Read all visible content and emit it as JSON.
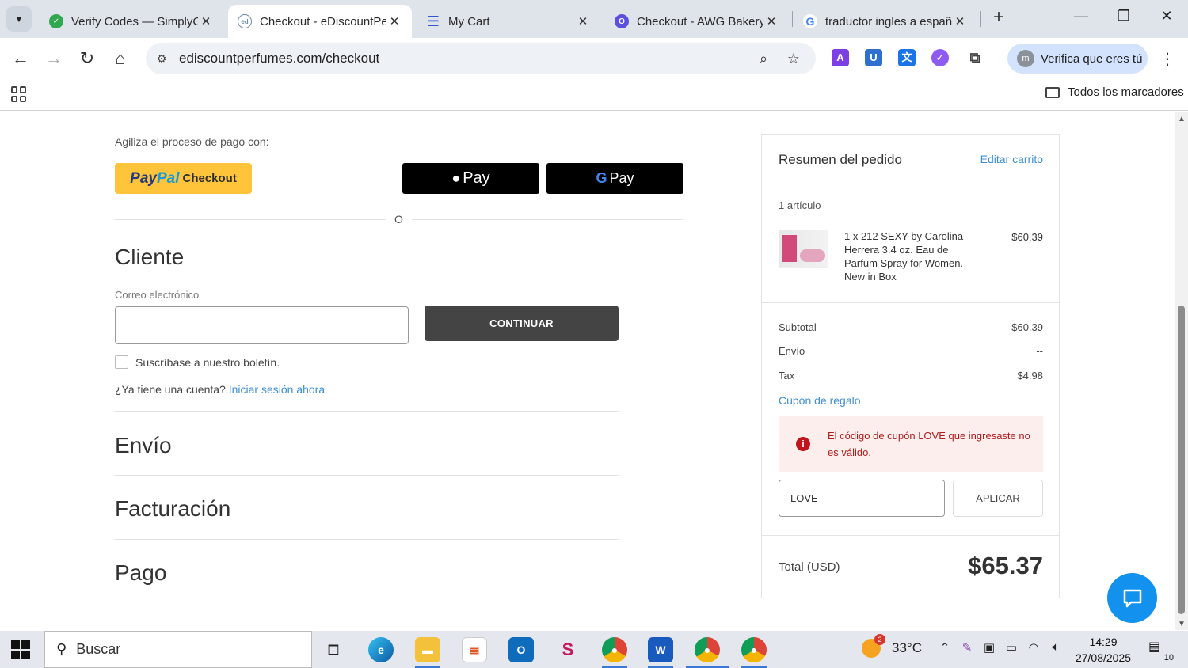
{
  "tabs": [
    {
      "title": "Verify Codes — SimplyCodes",
      "favicon": "simplycodes-icon",
      "color": "#2fa84f",
      "active": false
    },
    {
      "title": "Checkout - eDiscountPerfumes",
      "favicon": "ediscountperfumes-icon",
      "color": "#6f8aa3",
      "active": true
    },
    {
      "title": "My Cart",
      "favicon": "menu-icon",
      "color": "#3457d5",
      "active": false
    },
    {
      "title": "Checkout - AWG Bakery",
      "favicon": "awg-icon",
      "color": "#5b4fe0",
      "active": false
    },
    {
      "title": "traductor ingles a español",
      "favicon": "google-icon",
      "color": "#4285f4",
      "active": false
    }
  ],
  "toolbar": {
    "url": "ediscountperfumes.com/checkout",
    "profile_label": "Verifica que eres tú",
    "profile_initial": "m"
  },
  "bookmarks": {
    "all_label": "Todos los marcadores"
  },
  "checkout": {
    "express_label": "Agiliza el proceso de pago con:",
    "paypal_brand_a": "Pay",
    "paypal_brand_b": "Pal",
    "paypal_suffix": "Checkout",
    "applepay_label": "Pay",
    "gpay_label": "Pay",
    "or_text": "O",
    "customer_heading": "Cliente",
    "email_label": "Correo electrónico",
    "email_value": "",
    "continue_label": "CONTINUAR",
    "newsletter_label": "Suscríbase a nuestro boletín.",
    "account_prompt": "¿Ya tiene una cuenta?",
    "login_link": "Iniciar sesión ahora",
    "shipping_heading": "Envío",
    "billing_heading": "Facturación",
    "payment_heading": "Pago"
  },
  "summary": {
    "title": "Resumen del pedido",
    "edit_label": "Editar carrito",
    "item_count": "1 artículo",
    "product_name": "1 x 212 SEXY by Carolina Herrera 3.4 oz. Eau de Parfum Spray for Women. New in Box",
    "product_price": "$60.39",
    "subtotal_label": "Subtotal",
    "subtotal_value": "$60.39",
    "shipping_label": "Envío",
    "shipping_value": "--",
    "tax_label": "Tax",
    "tax_value": "$4.98",
    "coupon_link": "Cupón de regalo",
    "error_message": "El código de cupón LOVE que ingresaste no es válido.",
    "coupon_value": "LOVE",
    "apply_label": "APLICAR",
    "total_label": "Total (USD)",
    "total_value": "$65.37"
  },
  "taskbar": {
    "search_placeholder": "Buscar",
    "temperature": "33°C",
    "weather_badge": "2",
    "time": "14:29",
    "date": "27/08/2025",
    "notifications": "10"
  }
}
